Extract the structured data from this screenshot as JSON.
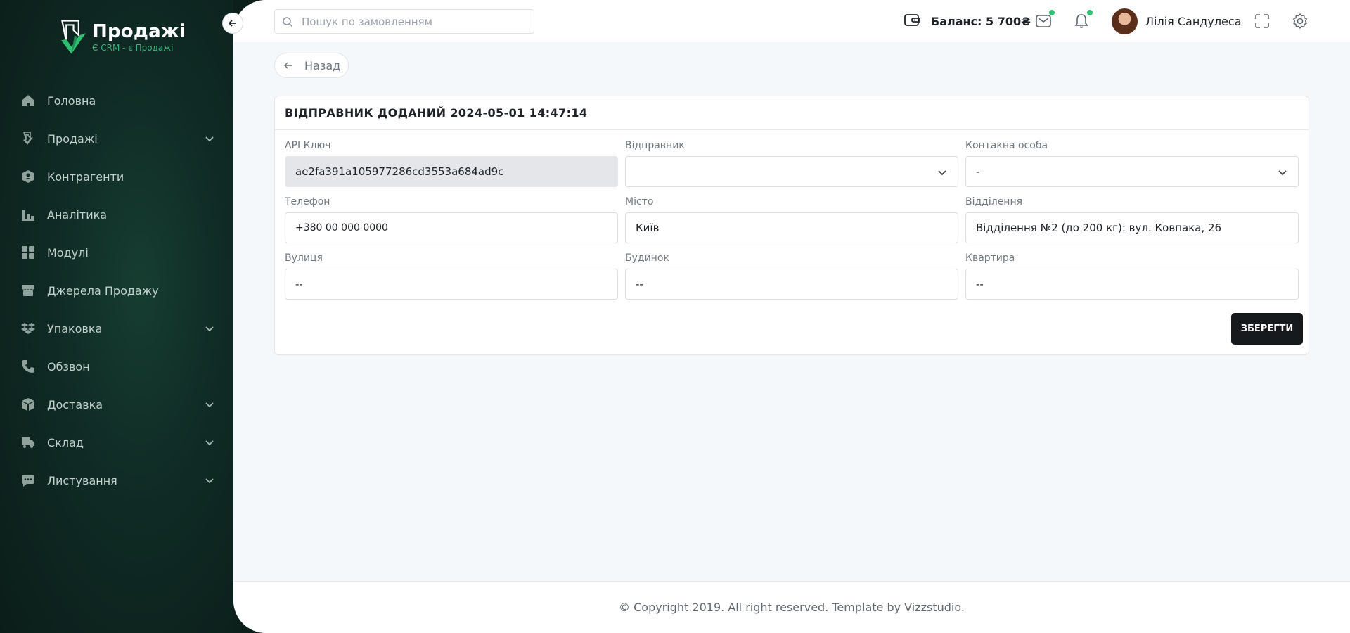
{
  "brand": {
    "title": "Продажі",
    "subtitle": "Є CRM - є Продажі",
    "accent": "#2fbf71"
  },
  "sidebar": {
    "items": [
      {
        "label": "Головна",
        "icon": "home-icon",
        "has_submenu": false
      },
      {
        "label": "Продажі",
        "icon": "sales-icon",
        "has_submenu": true
      },
      {
        "label": "Контрагенти",
        "icon": "contractors-icon",
        "has_submenu": false
      },
      {
        "label": "Аналітика",
        "icon": "analytics-icon",
        "has_submenu": false
      },
      {
        "label": "Модулі",
        "icon": "modules-icon",
        "has_submenu": false
      },
      {
        "label": "Джерела Продажу",
        "icon": "store-icon",
        "has_submenu": false
      },
      {
        "label": "Упаковка",
        "icon": "dropbox-icon",
        "has_submenu": true
      },
      {
        "label": "Обзвон",
        "icon": "phone-icon",
        "has_submenu": false
      },
      {
        "label": "Доставка",
        "icon": "box-icon",
        "has_submenu": true
      },
      {
        "label": "Склад",
        "icon": "warehouse-icon",
        "has_submenu": true
      },
      {
        "label": "Листування",
        "icon": "chat-icon",
        "has_submenu": true
      }
    ]
  },
  "topbar": {
    "search_placeholder": "Пошук по замовленням",
    "balance": "Баланс: 5 700₴",
    "user_name": "Лілія Сандулеса"
  },
  "page": {
    "back_label": "Назад",
    "card_title": "ВІДПРАВНИК ДОДАНИЙ 2024-05-01 14:47:14",
    "save_label": "ЗБЕРЕГТИ"
  },
  "form": {
    "api_key": {
      "label": "API Ключ",
      "value": "ae2fa391a105977286cd3553a684ad9c"
    },
    "sender": {
      "label": "Відправник",
      "value": ""
    },
    "contact": {
      "label": "Контакна особа",
      "value": "-"
    },
    "phone": {
      "label": "Телефон",
      "value": "+380 00 000 0000"
    },
    "city": {
      "label": "Місто",
      "value": "Київ"
    },
    "branch": {
      "label": "Відділення",
      "value": "Відділення №2 (до 200 кг): вул. Ковпака, 26"
    },
    "street": {
      "label": "Вулиця",
      "value": "--"
    },
    "house": {
      "label": "Будинок",
      "value": "--"
    },
    "apartment": {
      "label": "Квартира",
      "value": "--"
    }
  },
  "footer": {
    "text": "© Copyright 2019. All right reserved. Template by Vizzstudio."
  }
}
